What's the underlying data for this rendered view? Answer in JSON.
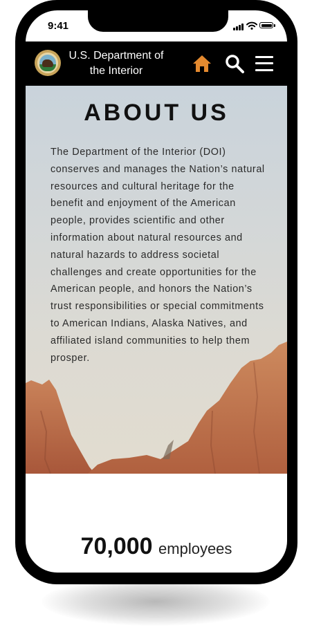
{
  "status_bar": {
    "time": "9:41",
    "icons": [
      "signal-icon",
      "wifi-icon",
      "battery-icon"
    ]
  },
  "header": {
    "logo": "department-seal",
    "title_line1": "U.S. Department of",
    "title_line2": "the Interior",
    "icons": [
      "home-icon",
      "search-icon",
      "menu-icon"
    ],
    "home_icon_color": "#e58a2f",
    "background_color": "#000000"
  },
  "about": {
    "title": "ABOUT US",
    "body": "The Department of the Interior (DOI) conserves and manages the Nation’s natural resources and cultural heritage for the benefit and enjoyment of the American people, provides scientific and other information about natural resources and natural hazards to address societal challenges and create opportunities for the American people, and honors the Nation’s trust responsibilities or special commitments to American Indians, Alaska Natives, and affiliated island communities to help them prosper."
  },
  "stats": {
    "value": "70,000",
    "label": "employees"
  }
}
